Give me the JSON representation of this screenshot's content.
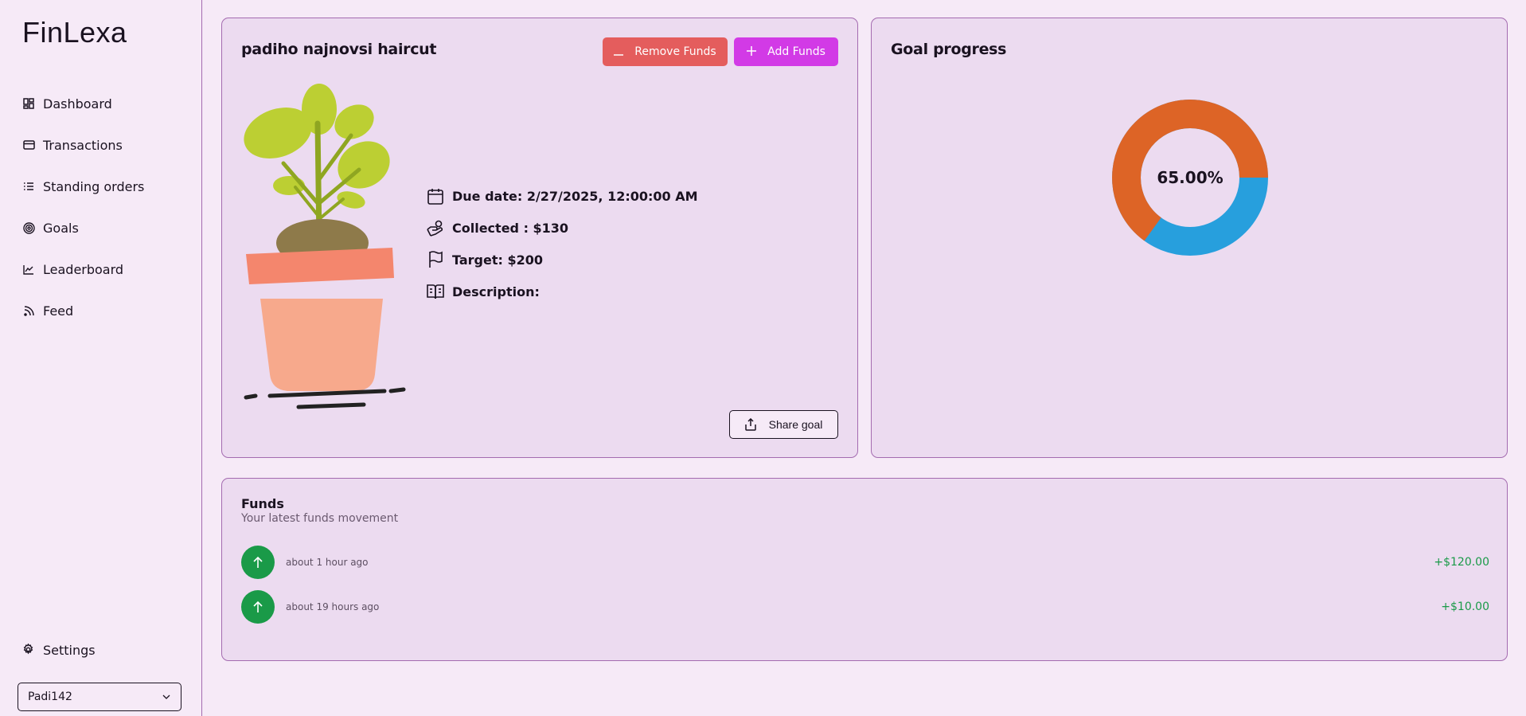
{
  "app": {
    "name": "FinLexa"
  },
  "sidebar": {
    "items": [
      {
        "label": "Dashboard",
        "icon": "dashboard-icon"
      },
      {
        "label": "Transactions",
        "icon": "card-icon"
      },
      {
        "label": "Standing orders",
        "icon": "list-icon"
      },
      {
        "label": "Goals",
        "icon": "target-icon"
      },
      {
        "label": "Leaderboard",
        "icon": "chart-line-icon"
      },
      {
        "label": "Feed",
        "icon": "rss-icon"
      }
    ],
    "settings_label": "Settings",
    "user": {
      "selected": "Padi142"
    }
  },
  "goal": {
    "title": "padiho najnovsi haircut",
    "remove_label": "Remove Funds",
    "add_label": "Add Funds",
    "due_date": "Due date: 2/27/2025, 12:00:00 AM",
    "collected": "Collected : $130",
    "target": "Target: $200",
    "description": "Description:",
    "share_label": "Share goal"
  },
  "progress": {
    "title": "Goal progress",
    "percent_label": "65.00%",
    "percent": 65,
    "colors": {
      "main": "#dd6426",
      "accent": "#279fdd"
    }
  },
  "funds": {
    "title": "Funds",
    "subtitle": "Your latest funds movement",
    "items": [
      {
        "time": "about 1 hour ago",
        "amount": "+$120.00"
      },
      {
        "time": "about 19 hours ago",
        "amount": "+$10.00"
      }
    ]
  },
  "colors": {
    "remove": "#e45d5d",
    "add": "#d23ae6",
    "positive": "#1a9a48"
  }
}
